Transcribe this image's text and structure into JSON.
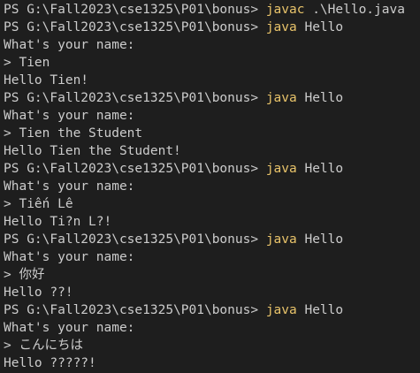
{
  "colors": {
    "background": "#1e1e1e",
    "text": "#cccccc",
    "command": "#e8c36a"
  },
  "lines": [
    {
      "prompt": "PS G:\\Fall2023\\cse1325\\P01\\bonus> ",
      "cmd": "javac",
      "args": " .\\Hello.java"
    },
    {
      "prompt": "PS G:\\Fall2023\\cse1325\\P01\\bonus> ",
      "cmd": "java",
      "args": " Hello"
    },
    {
      "text": "What's your name:"
    },
    {
      "text": "> Tien"
    },
    {
      "text": "Hello Tien!"
    },
    {
      "prompt": "PS G:\\Fall2023\\cse1325\\P01\\bonus> ",
      "cmd": "java",
      "args": " Hello"
    },
    {
      "text": "What's your name:"
    },
    {
      "text": "> Tien the Student"
    },
    {
      "text": "Hello Tien the Student!"
    },
    {
      "prompt": "PS G:\\Fall2023\\cse1325\\P01\\bonus> ",
      "cmd": "java",
      "args": " Hello"
    },
    {
      "text": "What's your name:"
    },
    {
      "text": "> Tiến Lê"
    },
    {
      "text": "Hello Ti?n L?!"
    },
    {
      "prompt": "PS G:\\Fall2023\\cse1325\\P01\\bonus> ",
      "cmd": "java",
      "args": " Hello"
    },
    {
      "text": "What's your name:"
    },
    {
      "text": "> 你好"
    },
    {
      "text": "Hello ??!"
    },
    {
      "prompt": "PS G:\\Fall2023\\cse1325\\P01\\bonus> ",
      "cmd": "java",
      "args": " Hello"
    },
    {
      "text": "What's your name:"
    },
    {
      "text": "> こんにちは"
    },
    {
      "text": "Hello ?????!"
    }
  ]
}
